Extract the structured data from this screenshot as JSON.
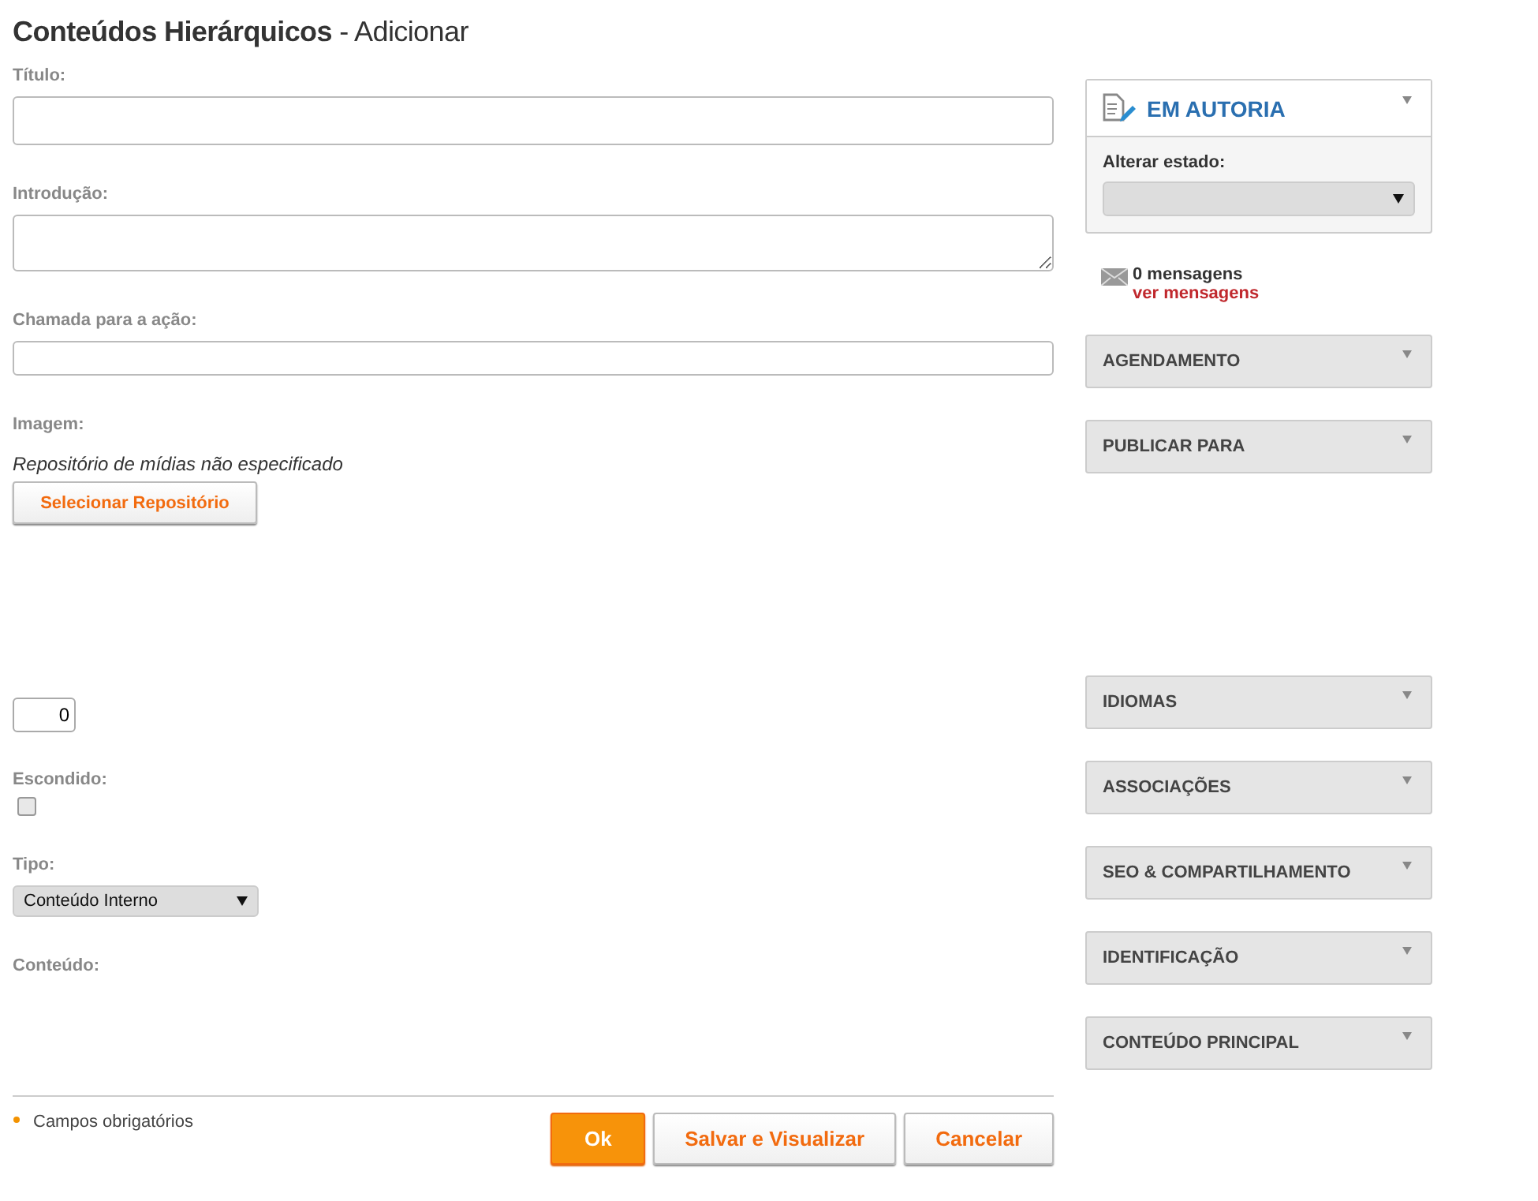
{
  "page_title": {
    "main": "Conteúdos Hierárquicos",
    "suffix": "- Adicionar"
  },
  "form": {
    "fields": [
      {
        "kind": "text",
        "label": "Título:"
      },
      {
        "kind": "textarea",
        "label": "Introdução:"
      },
      {
        "kind": "small-text",
        "label": "Chamada para a ação:"
      },
      {
        "kind": "media",
        "label": "Imagem:",
        "note": "Repositório de mídias não especificado",
        "button": "Selecionar Repositório"
      },
      {
        "kind": "number",
        "value": "0"
      },
      {
        "kind": "checkbox",
        "label": "Escondido:",
        "checked": false
      },
      {
        "kind": "select",
        "label": "Tipo:",
        "value": "Conteúdo Interno"
      },
      {
        "kind": "editor",
        "label": "Conteúdo:"
      }
    ]
  },
  "footer": {
    "required_note": "Campos obrigatórios",
    "buttons": [
      {
        "label": "Ok",
        "primary": true
      },
      {
        "label": "Salvar e Visualizar",
        "primary": false
      },
      {
        "label": "Cancelar",
        "primary": false
      }
    ]
  },
  "sidebar": {
    "status": {
      "title": "EM AUTORIA",
      "change_label": "Alterar estado:"
    },
    "messages": {
      "count": "0 mensagens",
      "link": "ver mensagens"
    },
    "panel_groups": [
      {
        "panels": [
          {
            "title": "AGENDAMENTO",
            "expanded": false
          },
          {
            "title": "PUBLICAR PARA",
            "expanded": false
          }
        ]
      },
      {
        "panels": [
          {
            "title": "IDIOMAS",
            "expanded": false
          },
          {
            "title": "ASSOCIAÇÕES",
            "expanded": false
          },
          {
            "title": "SEO & COMPARTILHAMENTO",
            "expanded": false
          },
          {
            "title": "IDENTIFICAÇÃO",
            "expanded": false
          },
          {
            "title": "CONTEÚDO PRINCIPAL",
            "expanded": false
          }
        ]
      }
    ]
  }
}
